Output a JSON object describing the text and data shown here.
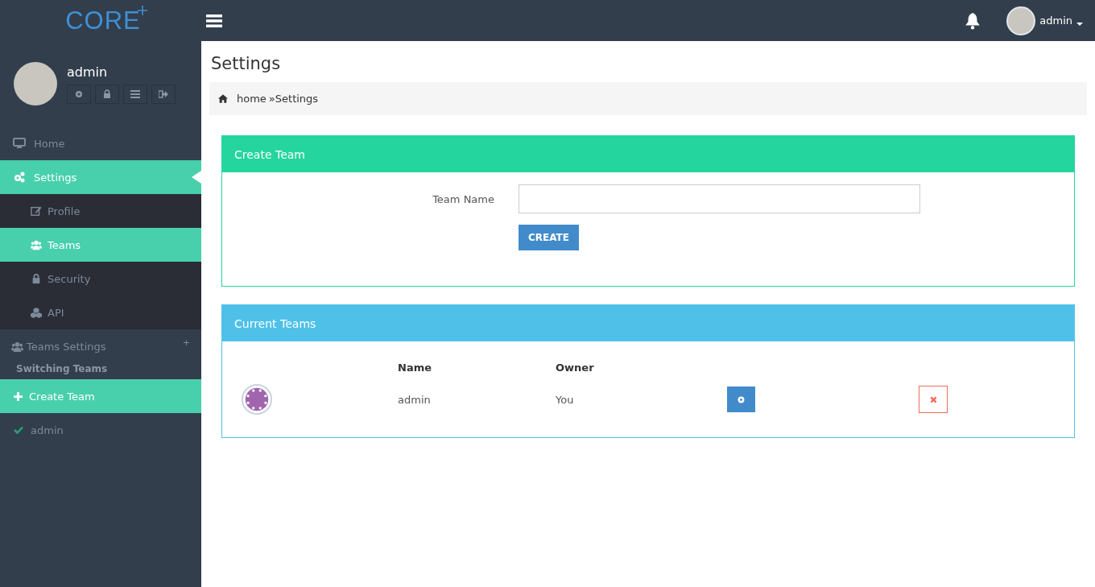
{
  "topbar": {
    "logo": "CORE",
    "user": "admin"
  },
  "profile": {
    "name": "admin"
  },
  "nav": [
    {
      "label": "Home",
      "selected": false
    },
    {
      "label": "Settings",
      "selected": true,
      "expanded": true,
      "children": [
        {
          "label": "Profile",
          "selected": false
        },
        {
          "label": "Teams",
          "selected": true
        },
        {
          "label": "Security",
          "selected": false
        },
        {
          "label": "API",
          "selected": false
        }
      ]
    }
  ],
  "teams_menu": {
    "title": "Teams Settings",
    "toggle": "+",
    "subtitle": "Switching Teams",
    "create": "Create Team",
    "teams": [
      {
        "name": "admin",
        "current": true
      }
    ]
  },
  "page": {
    "title": "Settings",
    "breadcrumb": [
      "home",
      "»Settings"
    ]
  },
  "create_panel": {
    "title": "Create Team",
    "label": "Team Name",
    "button": "CREATE"
  },
  "teams_panel": {
    "title": "Current Teams",
    "columns": [
      "Name",
      "Owner"
    ],
    "rows": [
      {
        "name": "admin",
        "owner": "You"
      }
    ]
  }
}
